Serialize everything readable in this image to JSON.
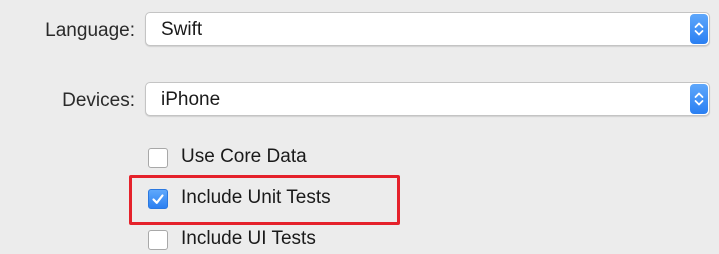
{
  "language": {
    "label": "Language:",
    "value": "Swift"
  },
  "devices": {
    "label": "Devices:",
    "value": "iPhone"
  },
  "checkboxes": [
    {
      "label": "Use Core Data",
      "checked": false
    },
    {
      "label": "Include Unit Tests",
      "checked": true
    },
    {
      "label": "Include UI Tests",
      "checked": false
    }
  ],
  "colors": {
    "accent": "#2a7ff2",
    "highlight_border": "#e5222b",
    "background": "#ececec"
  },
  "icons": {
    "popup_stepper": "up-down-chevron-icon",
    "checkmark": "checkmark-icon"
  }
}
